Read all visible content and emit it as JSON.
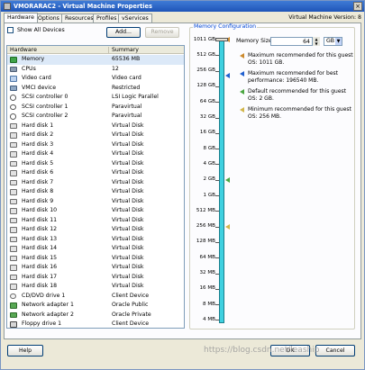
{
  "window": {
    "title": "VMORARAC2 - Virtual Machine Properties",
    "close_glyph": "×",
    "vm_version": "Virtual Machine Version: 8"
  },
  "tabs": [
    "Hardware",
    "Options",
    "Resources",
    "Profiles",
    "vServices"
  ],
  "hardware_panel": {
    "show_all_devices_label": "Show All Devices",
    "add_label": "Add...",
    "remove_label": "Remove",
    "columns": [
      "Hardware",
      "Summary"
    ],
    "rows": [
      {
        "name": "Memory",
        "summary": "65536 MB",
        "icon": "memory-icon",
        "selected": true
      },
      {
        "name": "CPUs",
        "summary": "12",
        "icon": "cpu-icon"
      },
      {
        "name": "Video card",
        "summary": "Video card",
        "icon": "video-card-icon"
      },
      {
        "name": "VMCI device",
        "summary": "Restricted",
        "icon": "vmci-icon"
      },
      {
        "name": "SCSI controller 0",
        "summary": "LSI Logic Parallel",
        "icon": "scsi-controller-icon"
      },
      {
        "name": "SCSI controller 1",
        "summary": "Paravirtual",
        "icon": "scsi-controller-icon"
      },
      {
        "name": "SCSI controller 2",
        "summary": "Paravirtual",
        "icon": "scsi-controller-icon"
      },
      {
        "name": "Hard disk 1",
        "summary": "Virtual Disk",
        "icon": "hard-disk-icon"
      },
      {
        "name": "Hard disk 2",
        "summary": "Virtual Disk",
        "icon": "hard-disk-icon"
      },
      {
        "name": "Hard disk 3",
        "summary": "Virtual Disk",
        "icon": "hard-disk-icon"
      },
      {
        "name": "Hard disk 4",
        "summary": "Virtual Disk",
        "icon": "hard-disk-icon"
      },
      {
        "name": "Hard disk 5",
        "summary": "Virtual Disk",
        "icon": "hard-disk-icon"
      },
      {
        "name": "Hard disk 6",
        "summary": "Virtual Disk",
        "icon": "hard-disk-icon"
      },
      {
        "name": "Hard disk 7",
        "summary": "Virtual Disk",
        "icon": "hard-disk-icon"
      },
      {
        "name": "Hard disk 8",
        "summary": "Virtual Disk",
        "icon": "hard-disk-icon"
      },
      {
        "name": "Hard disk 9",
        "summary": "Virtual Disk",
        "icon": "hard-disk-icon"
      },
      {
        "name": "Hard disk 10",
        "summary": "Virtual Disk",
        "icon": "hard-disk-icon"
      },
      {
        "name": "Hard disk 11",
        "summary": "Virtual Disk",
        "icon": "hard-disk-icon"
      },
      {
        "name": "Hard disk 12",
        "summary": "Virtual Disk",
        "icon": "hard-disk-icon"
      },
      {
        "name": "Hard disk 13",
        "summary": "Virtual Disk",
        "icon": "hard-disk-icon"
      },
      {
        "name": "Hard disk 14",
        "summary": "Virtual Disk",
        "icon": "hard-disk-icon"
      },
      {
        "name": "Hard disk 15",
        "summary": "Virtual Disk",
        "icon": "hard-disk-icon"
      },
      {
        "name": "Hard disk 16",
        "summary": "Virtual Disk",
        "icon": "hard-disk-icon"
      },
      {
        "name": "Hard disk 17",
        "summary": "Virtual Disk",
        "icon": "hard-disk-icon"
      },
      {
        "name": "Hard disk 18",
        "summary": "Virtual Disk",
        "icon": "hard-disk-icon"
      },
      {
        "name": "CD/DVD drive 1",
        "summary": "Client Device",
        "icon": "cd-dvd-icon"
      },
      {
        "name": "Network adapter 1",
        "summary": "Oracle Public",
        "icon": "network-adapter-icon"
      },
      {
        "name": "Network adapter 2",
        "summary": "Oracle Private",
        "icon": "network-adapter-icon"
      },
      {
        "name": "Floppy drive 1",
        "summary": "Client Device",
        "icon": "floppy-icon"
      }
    ]
  },
  "memory_config": {
    "group_label": "Memory Configuration",
    "size_label": "Memory Size:",
    "size_value": "64",
    "unit": "GB",
    "scale_labels": [
      "1011 GB",
      "512 GB",
      "256 GB",
      "128 GB",
      "64 GB",
      "32 GB",
      "16 GB",
      "8 GB",
      "4 GB",
      "2 GB",
      "1 GB",
      "512 MB",
      "256 MB",
      "128 MB",
      "64 MB",
      "32 MB",
      "16 MB",
      "8 MB",
      "4 MB"
    ],
    "notes": [
      {
        "text": "Maximum recommended for this guest OS: 1011 GB.",
        "color": "#cc8a2e"
      },
      {
        "text": "Maximum recommended for best performance: 196540 MB.",
        "color": "#1f5fcf"
      },
      {
        "text": "Default recommended for this guest OS: 2 GB.",
        "color": "#4aa640"
      },
      {
        "text": "Minimum recommended for this guest OS: 256 MB.",
        "color": "#d2b64a"
      }
    ]
  },
  "footer": {
    "help_label": "Help",
    "ok_label": "OK",
    "cancel_label": "Cancel",
    "watermark": "https://blog.csdn.net/leaship"
  }
}
